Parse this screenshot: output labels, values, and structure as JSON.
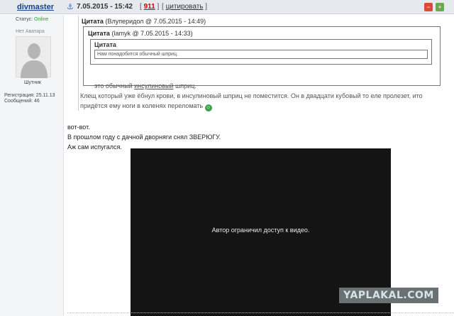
{
  "post": {
    "username": "divmaster",
    "date": "7.05.2015 - 15:42",
    "rating_open": "[",
    "rating": "911",
    "rating_close": "]",
    "quote_open": "[",
    "quote_label": "цитировать",
    "quote_close": "]",
    "minus_icon": "minus-vote-icon",
    "plus_icon": "plus-vote-icon"
  },
  "user": {
    "status_label": "Статус:",
    "status_value": "Online",
    "no_avatar": "Нет Аватара",
    "rank": "Шутник",
    "registration": "Регистрация: 25.11.13",
    "messages": "Сообщений: 46"
  },
  "quotes": {
    "outer": {
      "title": "Цитата",
      "author": "(Влупеpидол @ 7.05.2015 - 14:49)",
      "text": "Клещ который уже ёбнул крови, в инсулиновый шприц не поместится. Он в двадцати кубовый то еле пролезет, ито придётся ему ноги в коленях переломать"
    },
    "inner": {
      "title": "Цитата",
      "author": "(lamyk @ 7.05.2015 - 14:33)",
      "text_before": "это обычный ",
      "text_link": "инсулиновый",
      "text_after": " шприц."
    },
    "deep": {
      "title": "Цитата",
      "text": "Нам понадобится обычный шприц."
    }
  },
  "post_text": [
    "вот-вот.",
    "В прошлом году с дачной дворняги снял ЗВЕРЮГУ.",
    "Аж сам испугался."
  ],
  "video": {
    "message": "Автор ограничил доступ к видео."
  },
  "watermark": "YAPLAKAL.COM",
  "colors": {
    "username": "#1b3f8b",
    "rating": "#cc0000",
    "online": "#2a9d3a"
  }
}
